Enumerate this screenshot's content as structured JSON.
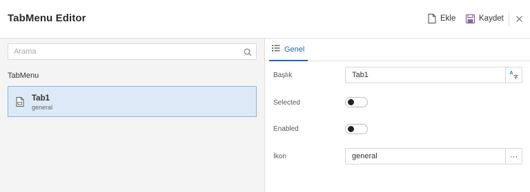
{
  "header": {
    "title": "TabMenu Editor",
    "add_label": "Ekle",
    "save_label": "Kaydet"
  },
  "sidebar": {
    "search_placeholder": "Arama",
    "section_label": "TabMenu",
    "items": [
      {
        "name": "Tab1",
        "subtitle": "general"
      }
    ]
  },
  "panel": {
    "tab_label": "Genel",
    "properties": {
      "baslik": {
        "label": "Başlık",
        "value": "Tab1"
      },
      "selected": {
        "label": "Selected",
        "value": false
      },
      "enabled": {
        "label": "Enabled",
        "value": false
      },
      "ikon": {
        "label": "İkon",
        "value": "general",
        "button": "···"
      }
    }
  },
  "colors": {
    "accent": "#1f66b0",
    "selected_item_bg": "#dce9f6",
    "selected_item_border": "#8ab4da",
    "save_icon": "#7a4a9a"
  }
}
